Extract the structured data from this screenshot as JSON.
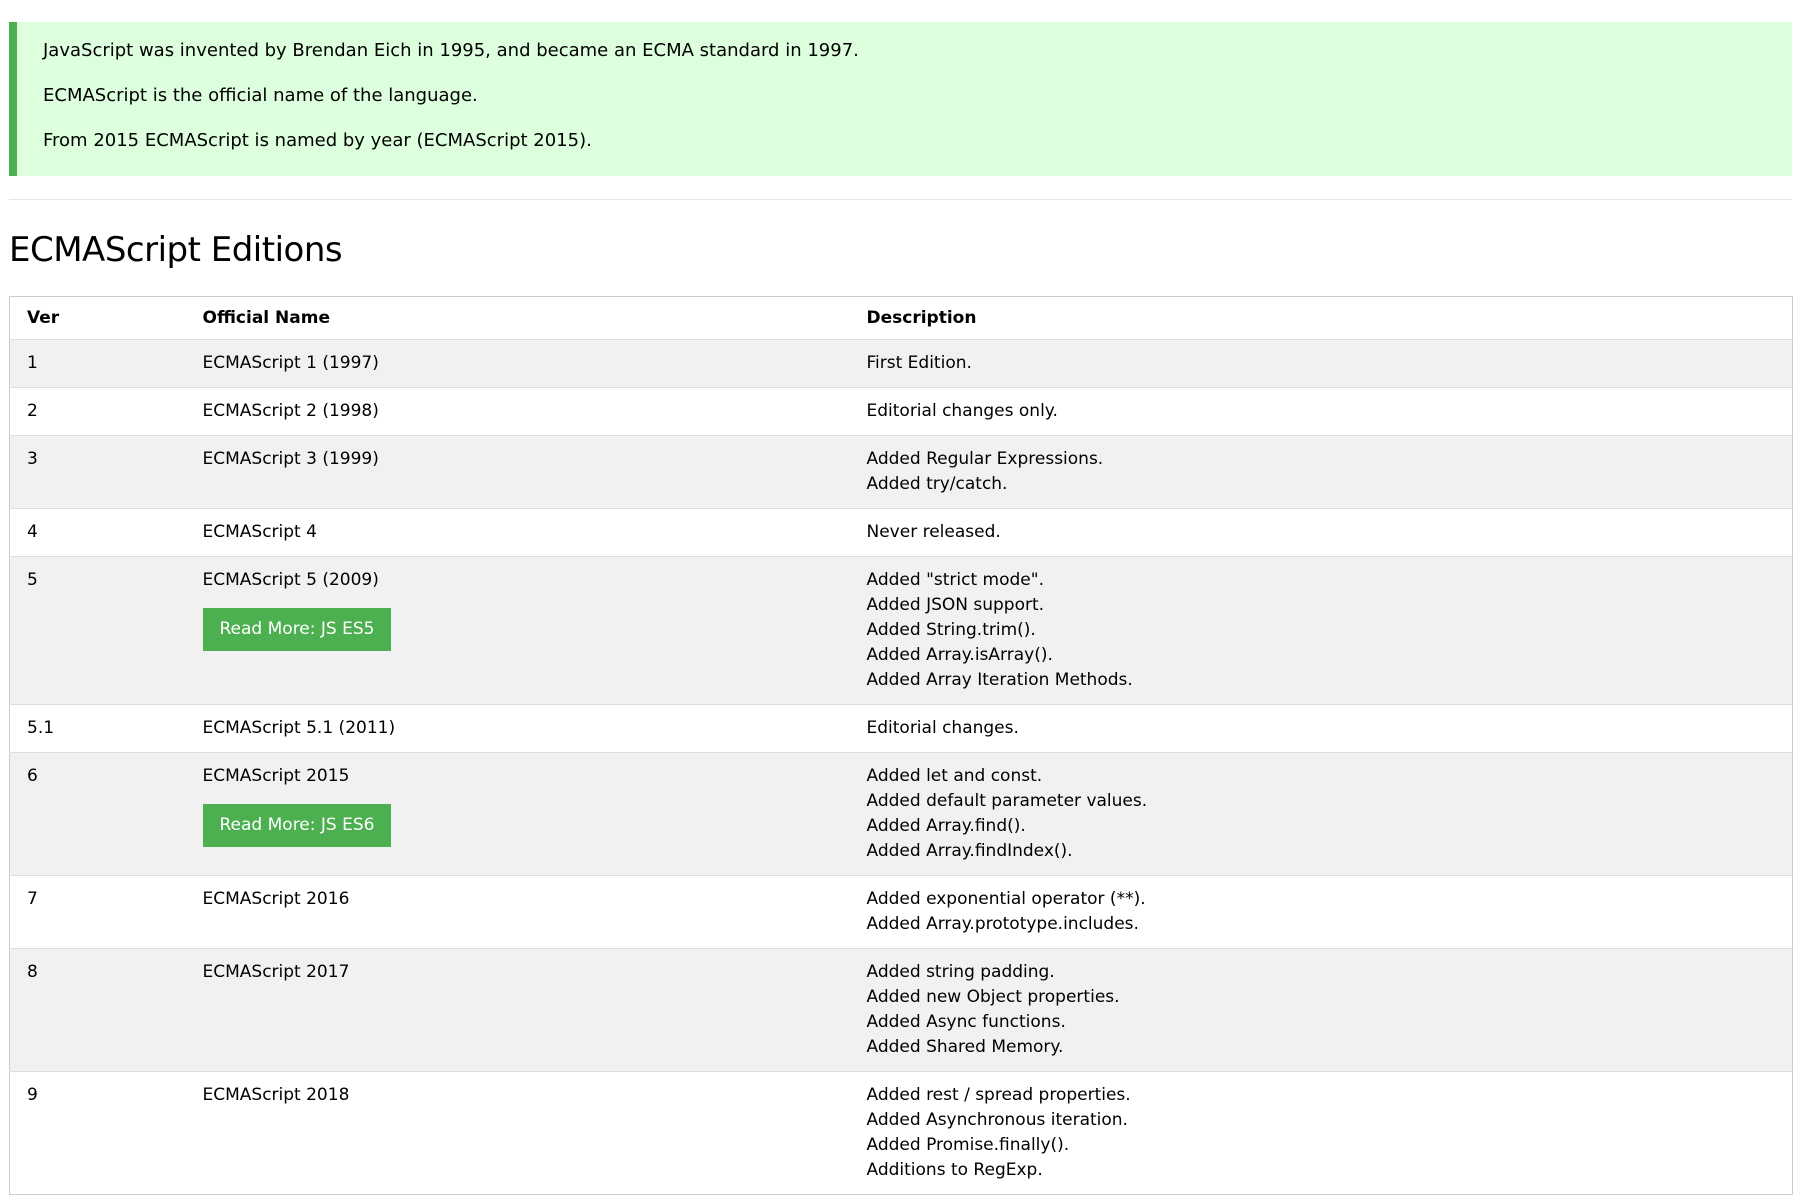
{
  "note": {
    "lines": [
      "JavaScript was invented by Brendan Eich in 1995, and became an ECMA standard in 1997.",
      "ECMAScript is the official name of the language.",
      "From 2015 ECMAScript is named by year (ECMAScript 2015)."
    ],
    "accent_color": "#4caf50",
    "background_color": "#ddffdd"
  },
  "section_title": "ECMAScript Editions",
  "table": {
    "headers": [
      "Ver",
      "Official Name",
      "Description"
    ],
    "rows": [
      {
        "ver": "1",
        "name": "ECMAScript 1 (1997)",
        "desc": [
          "First Edition."
        ]
      },
      {
        "ver": "2",
        "name": "ECMAScript 2 (1998)",
        "desc": [
          "Editorial changes only."
        ]
      },
      {
        "ver": "3",
        "name": "ECMAScript 3 (1999)",
        "desc": [
          "Added Regular Expressions.",
          "Added try/catch."
        ]
      },
      {
        "ver": "4",
        "name": "ECMAScript 4",
        "desc": [
          "Never released."
        ]
      },
      {
        "ver": "5",
        "name": "ECMAScript 5 (2009)",
        "button": "Read More: JS ES5",
        "desc": [
          "Added \"strict mode\".",
          "Added JSON support.",
          "Added String.trim().",
          "Added Array.isArray().",
          "Added Array Iteration Methods."
        ]
      },
      {
        "ver": "5.1",
        "name": "ECMAScript 5.1 (2011)",
        "desc": [
          "Editorial changes."
        ]
      },
      {
        "ver": "6",
        "name": "ECMAScript 2015",
        "button": "Read More: JS ES6",
        "desc": [
          "Added let and const.",
          "Added default parameter values.",
          "Added Array.find().",
          "Added Array.findIndex()."
        ]
      },
      {
        "ver": "7",
        "name": "ECMAScript 2016",
        "desc": [
          "Added exponential operator (**).",
          "Added Array.prototype.includes."
        ]
      },
      {
        "ver": "8",
        "name": "ECMAScript 2017",
        "desc": [
          "Added string padding.",
          "Added new Object properties.",
          "Added Async functions.",
          "Added Shared Memory."
        ]
      },
      {
        "ver": "9",
        "name": "ECMAScript 2018",
        "desc": [
          "Added rest / spread properties.",
          "Added Asynchronous iteration.",
          "Added Promise.finally().",
          "Additions to RegExp."
        ]
      }
    ],
    "button_color": "#4caf50"
  }
}
